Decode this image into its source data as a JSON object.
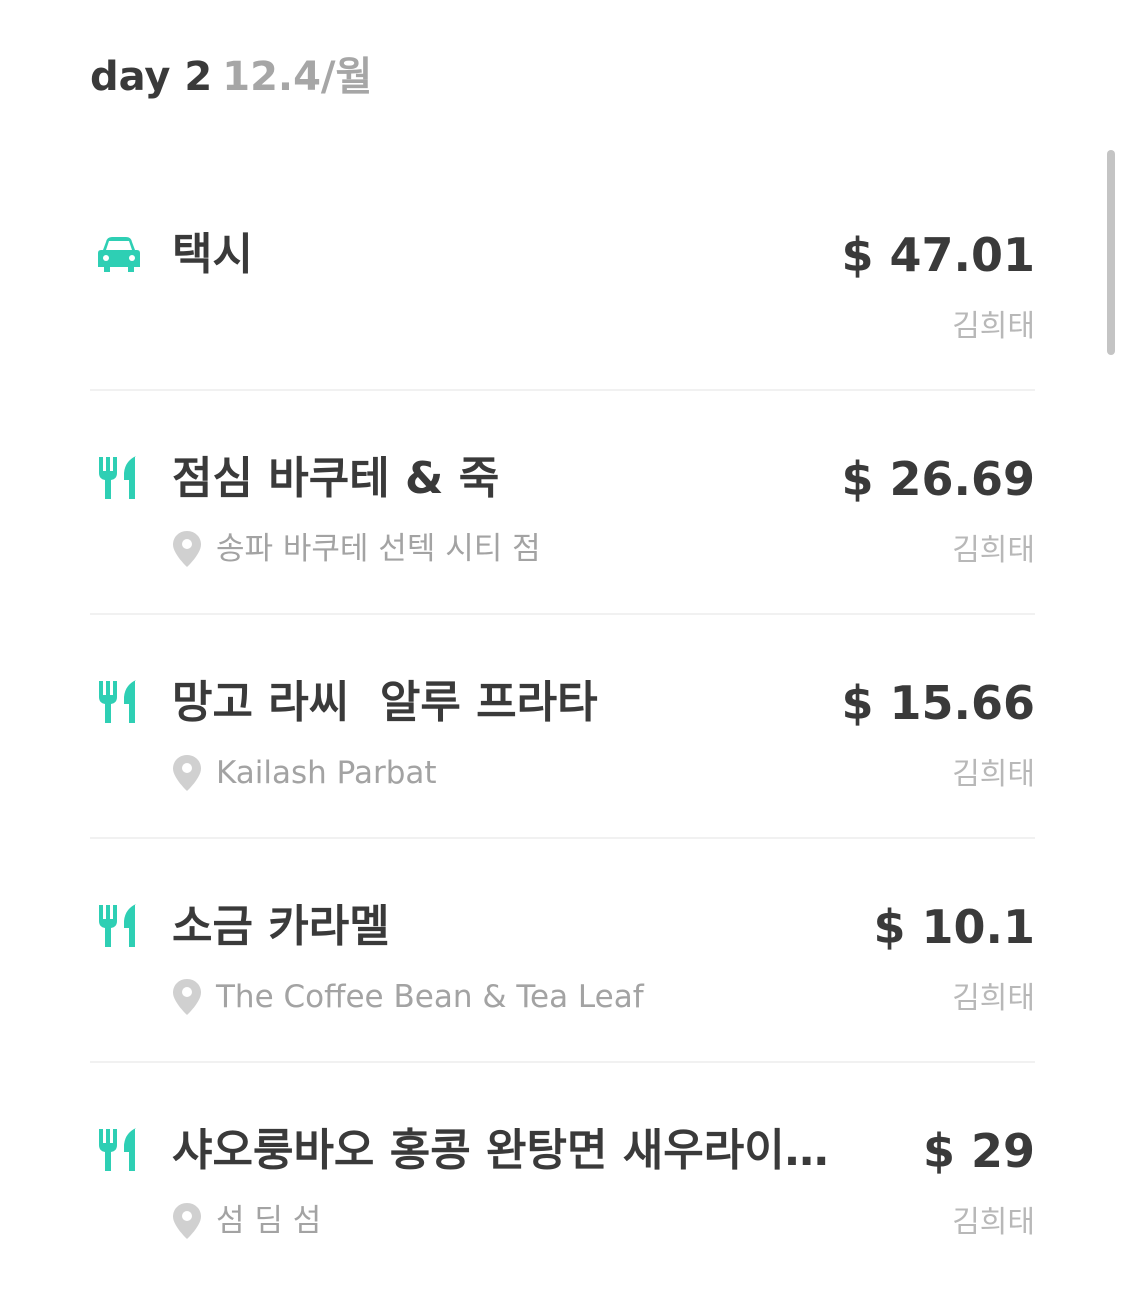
{
  "header": {
    "day_label": "day 2",
    "date_label": "12.4/월"
  },
  "colors": {
    "accent": "#2ecfb4",
    "text_primary": "#3a3a3a",
    "text_secondary": "#a3a3a3",
    "divider": "#f1f1f1",
    "pin": "#d0d0d0"
  },
  "expenses": [
    {
      "category_icon": "car-icon",
      "title": "택시",
      "amount": "$ 47.01",
      "place": "",
      "payer": "김희태"
    },
    {
      "category_icon": "fork-knife-icon",
      "title": "점심 바쿠테 & 죽",
      "amount": "$ 26.69",
      "place": "송파 바쿠테 선텍 시티 점",
      "payer": "김희태"
    },
    {
      "category_icon": "fork-knife-icon",
      "title": "망고 라씨  알루 프라타",
      "amount": "$ 15.66",
      "place": "Kailash Parbat",
      "payer": "김희태"
    },
    {
      "category_icon": "fork-knife-icon",
      "title": "소금 카라멜",
      "amount": "$ 10.1",
      "place": "The Coffee Bean & Tea Leaf",
      "payer": "김희태"
    },
    {
      "category_icon": "fork-knife-icon",
      "title": "샤오룽바오 홍콩 완탕면 새우라이…",
      "amount": "$ 29",
      "place": "섬 딤 섬",
      "payer": "김희태"
    }
  ]
}
